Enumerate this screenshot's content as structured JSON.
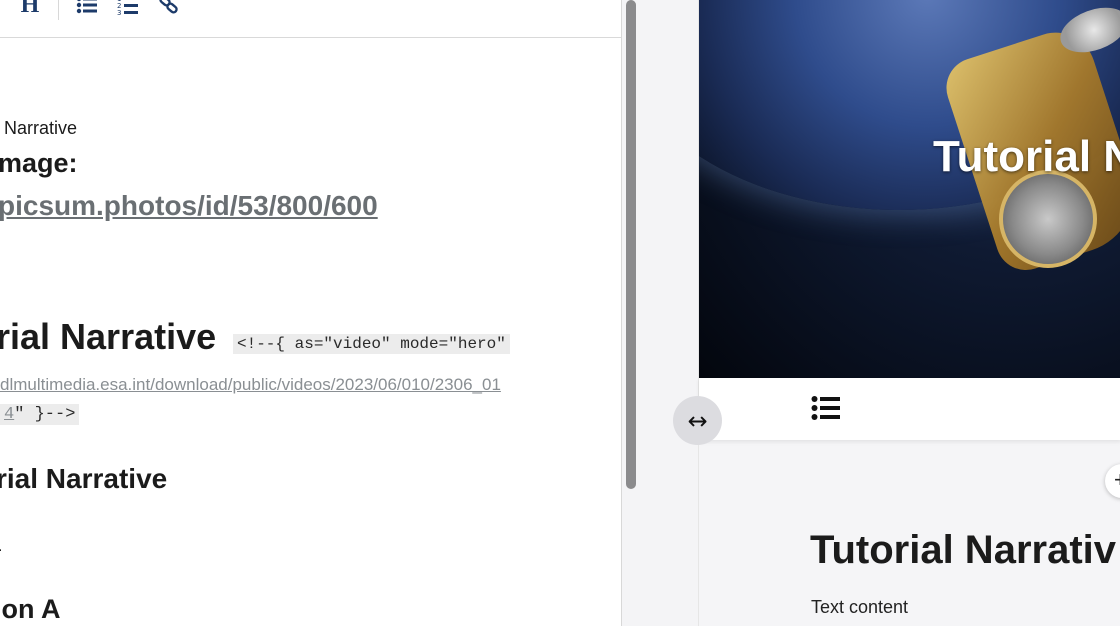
{
  "toolbar": {
    "heading_glyph": "H",
    "icons": [
      "heading-icon",
      "bullet-list-icon",
      "numbered-list-icon",
      "link-icon"
    ]
  },
  "editor": {
    "line_narrative": "Narrative",
    "line_image_label": "mage:",
    "line_image_url": "picsum.photos/id/53/800/600",
    "heading1_text": "rial Narrative",
    "heading1_code": "<!--{ as=\"video\" mode=\"hero\"",
    "video_url_line1": "dlmultimedia.esa.int/download/public/videos/2023/06/010/2306_01",
    "video_url_line2_link": "4",
    "video_url_line2_code": "\" }-->",
    "heading2_text": "rial Narrative",
    "dot_text": ".",
    "heading3_text": "ion A"
  },
  "preview": {
    "hero_title": "Tutorial N",
    "title": "Tutorial Narrativ",
    "text": "Text content",
    "add_glyph": "+"
  },
  "resize_handle": {
    "glyph": "↔"
  },
  "colors": {
    "toolbar_icon": "#1d3b6a",
    "link_gray": "#6a6f73",
    "scrollbar": "#8b8b8d"
  }
}
